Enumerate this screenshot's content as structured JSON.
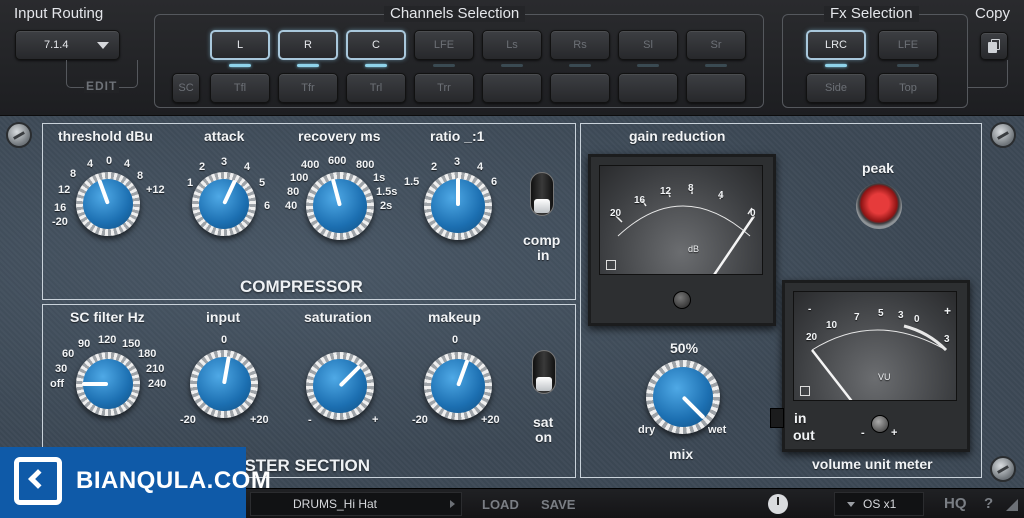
{
  "input_routing": {
    "title": "Input Routing",
    "format": "7.1.4",
    "edit_label": "EDIT"
  },
  "channels_selection": {
    "title": "Channels Selection",
    "row1": [
      {
        "label": "L",
        "state": "on"
      },
      {
        "label": "R",
        "state": "on"
      },
      {
        "label": "C",
        "state": "on"
      },
      {
        "label": "LFE",
        "state": "dim"
      },
      {
        "label": "Ls",
        "state": "dim"
      },
      {
        "label": "Rs",
        "state": "dim"
      },
      {
        "label": "Sl",
        "state": "dim"
      },
      {
        "label": "Sr",
        "state": "dim"
      }
    ],
    "sc_label": "SC",
    "row2": [
      {
        "label": "Tfl",
        "state": "dim"
      },
      {
        "label": "Tfr",
        "state": "dim"
      },
      {
        "label": "Trl",
        "state": "dim"
      },
      {
        "label": "Trr",
        "state": "dim"
      },
      {
        "label": "",
        "state": "blank"
      },
      {
        "label": "",
        "state": "blank"
      },
      {
        "label": "",
        "state": "blank"
      },
      {
        "label": "",
        "state": "blank"
      }
    ]
  },
  "fx_selection": {
    "title": "Fx Selection",
    "buttons": [
      {
        "label": "LRC",
        "state": "on"
      },
      {
        "label": "LFE",
        "state": "dim"
      },
      {
        "label": "Side",
        "state": "dim"
      },
      {
        "label": "Top",
        "state": "dim"
      }
    ]
  },
  "copy": {
    "title": "Copy"
  },
  "compressor": {
    "title": "COMPRESSOR",
    "threshold": {
      "label": "threshold dBu",
      "ticks": [
        "-20",
        "16",
        "12",
        "8",
        "4",
        "0",
        "4",
        "8",
        "+12"
      ]
    },
    "attack": {
      "label": "attack",
      "ticks": [
        "1",
        "2",
        "3",
        "4",
        "5",
        "6"
      ]
    },
    "recovery": {
      "label": "recovery ms",
      "ticks": [
        "40",
        "80",
        "100",
        "400",
        "600",
        "800",
        "1s",
        "1.5s",
        "2s"
      ]
    },
    "ratio": {
      "label": "ratio _:1",
      "ticks": [
        "1.5",
        "2",
        "3",
        "4",
        "6"
      ]
    },
    "comp_in": {
      "line1": "comp",
      "line2": "in"
    }
  },
  "master": {
    "title": "MASTER SECTION",
    "sc_filter": {
      "label": "SC filter Hz",
      "ticks": [
        "off",
        "30",
        "60",
        "90",
        "120",
        "150",
        "180",
        "210",
        "240"
      ]
    },
    "input": {
      "label": "input",
      "ticks": [
        "0",
        "-20",
        "+20"
      ]
    },
    "saturation": {
      "label": "saturation",
      "ticks": [
        "-",
        "+"
      ]
    },
    "makeup": {
      "label": "makeup",
      "ticks": [
        "0",
        "-20",
        "+20"
      ]
    },
    "sat_on": {
      "line1": "sat",
      "line2": "on"
    }
  },
  "gain_reduction": {
    "label": "gain reduction",
    "scale": [
      "20",
      "16",
      "12",
      "8",
      "4",
      "0"
    ],
    "unit": "dB"
  },
  "peak": {
    "label": "peak"
  },
  "mix": {
    "value": "50%",
    "label": "mix",
    "dry": "dry",
    "wet": "wet"
  },
  "vu_meter": {
    "label": "volume unit meter",
    "scale": [
      "-",
      "20",
      "10",
      "7",
      "5",
      "3",
      "0",
      "+",
      "3"
    ],
    "unit": "VU",
    "in_label": "in",
    "out_label": "out",
    "minus": "-",
    "plus": "+"
  },
  "bottom": {
    "preset": "DRUMS_Hi Hat",
    "load": "LOAD",
    "save": "SAVE",
    "os": "OS x1",
    "hq": "HQ",
    "help": "?"
  },
  "watermark": {
    "text": "BIANQULA.COM"
  }
}
